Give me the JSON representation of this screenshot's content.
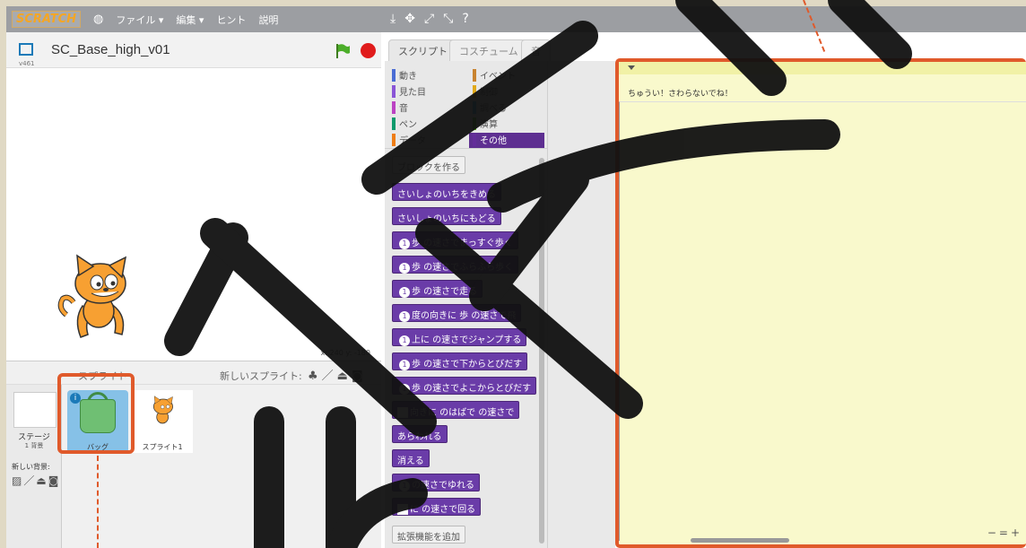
{
  "menubar": {
    "logo": "SCRATCH",
    "items": [
      "ファイル ▾",
      "編集 ▾",
      "ヒント",
      "説明"
    ],
    "tools": [
      "⤓",
      "✥",
      "⤢",
      "⤡",
      "?"
    ]
  },
  "stage": {
    "title": "SC_Base_high_v01",
    "version": "v461",
    "coords": "x: 240  y: -180"
  },
  "sprites": {
    "header_label": "スプライト",
    "new_sprite_label": "新しいスプライト:",
    "stage_name": "ステージ",
    "stage_bg_count": "1 背景",
    "new_bg_label": "新しい背景:",
    "items": [
      {
        "name": "バッグ",
        "selected": true
      },
      {
        "name": "スプライト1",
        "selected": false
      }
    ]
  },
  "tabs": [
    "スクリプト",
    "コスチューム",
    "音"
  ],
  "categories": {
    "left": [
      {
        "label": "動き",
        "color": "#4a6cd4"
      },
      {
        "label": "見た目",
        "color": "#8a55d7"
      },
      {
        "label": "音",
        "color": "#bb42c3"
      },
      {
        "label": "ペン",
        "color": "#0e9a6c"
      },
      {
        "label": "データ",
        "color": "#ee7d16"
      }
    ],
    "right": [
      {
        "label": "イベント",
        "color": "#c88330"
      },
      {
        "label": "制御",
        "color": "#e1a91a"
      },
      {
        "label": "調べる",
        "color": "#2ca5e2"
      },
      {
        "label": "演算",
        "color": "#5cb712"
      },
      {
        "label": "その他",
        "color": "#632d99",
        "selected": true
      }
    ]
  },
  "blocks": {
    "make_block": "ブロックを作る",
    "items": [
      "さいしょのいちをきめる",
      "さいしょのいちにもどる",
      "歩 の速さでまっすぐ歩く",
      "歩 の速さでふらふら歩く",
      "歩 の速さで走る",
      "度の向きに 歩 の速さで飛",
      "上に の速さでジャンプする",
      "歩 の速さで下からとびだす",
      "歩 の速さでよこからとびだす",
      "向きに のはばで の速さで",
      "あらわれる",
      "消える",
      "の速さでゆれる",
      "に の速さで回る"
    ],
    "extension": "拡張機能を追加"
  },
  "script_area": {
    "comment": "ちゅうい！さわらないでね！",
    "zoom": [
      "−",
      "=",
      "+"
    ]
  },
  "colors": {
    "highlight": "#e05a2b",
    "palette_block": "#6a3ca8"
  }
}
